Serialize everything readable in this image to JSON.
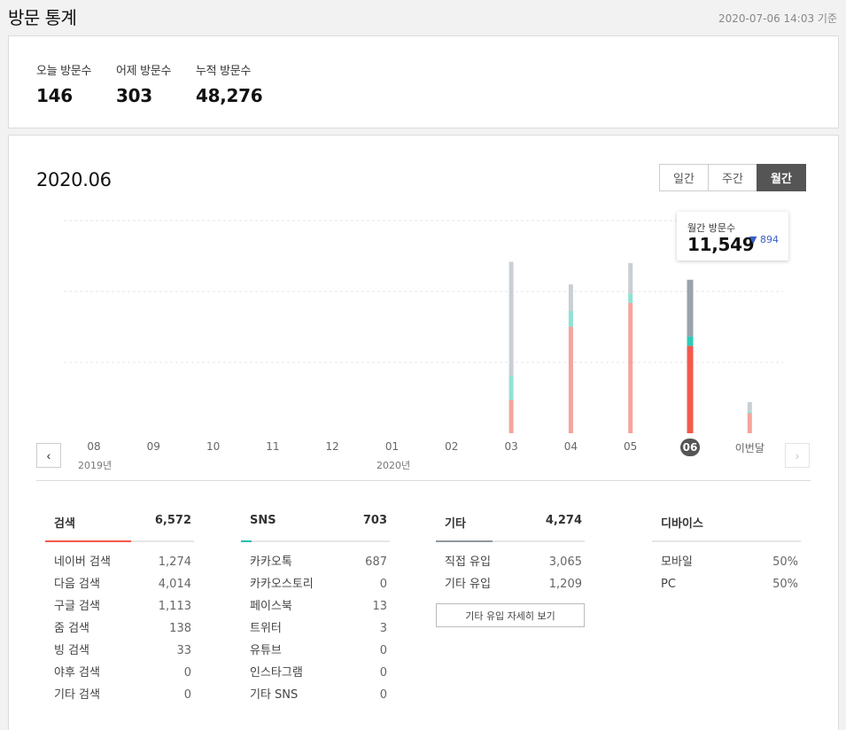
{
  "header": {
    "title": "방문 통계",
    "base_time": "2020-07-06 14:03 기준"
  },
  "summary": [
    {
      "label": "오늘 방문수",
      "value": "146"
    },
    {
      "label": "어제 방문수",
      "value": "303"
    },
    {
      "label": "누적 방문수",
      "value": "48,276"
    }
  ],
  "chart": {
    "period_title": "2020.06",
    "tabs": [
      {
        "label": "일간",
        "active": false
      },
      {
        "label": "주간",
        "active": false
      },
      {
        "label": "월간",
        "active": true
      }
    ],
    "tooltip": {
      "label": "월간 방문수",
      "value": "11,549",
      "delta": "▼ 894"
    },
    "years": [
      "2019년",
      "2020년"
    ]
  },
  "chart_data": {
    "type": "bar",
    "stacked": true,
    "categories": [
      "08",
      "09",
      "10",
      "11",
      "12",
      "01",
      "02",
      "03",
      "04",
      "05",
      "06",
      "이번달"
    ],
    "selected": "06",
    "ylim": [
      0,
      16000
    ],
    "grid": true,
    "series": [
      {
        "color": "#f25a4d",
        "values": [
          0,
          0,
          0,
          0,
          0,
          0,
          0,
          2500,
          8000,
          9800,
          6572,
          1500
        ]
      },
      {
        "color": "#2ccbb8",
        "values": [
          0,
          0,
          0,
          0,
          0,
          0,
          0,
          1800,
          1200,
          700,
          703,
          150
        ]
      },
      {
        "color": "#9aa3ab",
        "values": [
          0,
          0,
          0,
          0,
          0,
          0,
          0,
          8600,
          2000,
          2300,
          4274,
          700
        ]
      }
    ]
  },
  "breakdown": {
    "search": {
      "title": "검색",
      "total": "6,572",
      "color": "#f25a4d",
      "fill_ratio": 0.58,
      "rows": [
        {
          "label": "네이버 검색",
          "value": "1,274"
        },
        {
          "label": "다음 검색",
          "value": "4,014"
        },
        {
          "label": "구글 검색",
          "value": "1,113"
        },
        {
          "label": "줌 검색",
          "value": "138"
        },
        {
          "label": "빙 검색",
          "value": "33"
        },
        {
          "label": "야후 검색",
          "value": "0"
        },
        {
          "label": "기타 검색",
          "value": "0"
        }
      ]
    },
    "sns": {
      "title": "SNS",
      "total": "703",
      "color": "#1fbfb0",
      "fill_ratio": 0.07,
      "rows": [
        {
          "label": "카카오톡",
          "value": "687"
        },
        {
          "label": "카카오스토리",
          "value": "0"
        },
        {
          "label": "페이스북",
          "value": "13"
        },
        {
          "label": "트위터",
          "value": "3"
        },
        {
          "label": "유튜브",
          "value": "0"
        },
        {
          "label": "인스타그램",
          "value": "0"
        },
        {
          "label": "기타 SNS",
          "value": "0"
        }
      ]
    },
    "other": {
      "title": "기타",
      "total": "4,274",
      "color": "#8e979f",
      "fill_ratio": 0.38,
      "rows": [
        {
          "label": "직접 유입",
          "value": "3,065"
        },
        {
          "label": "기타 유입",
          "value": "1,209"
        }
      ],
      "detail_button": "기타 유입 자세히 보기"
    },
    "device": {
      "title": "디바이스",
      "rows": [
        {
          "label": "모바일",
          "value": "50%"
        },
        {
          "label": "PC",
          "value": "50%"
        }
      ]
    }
  }
}
